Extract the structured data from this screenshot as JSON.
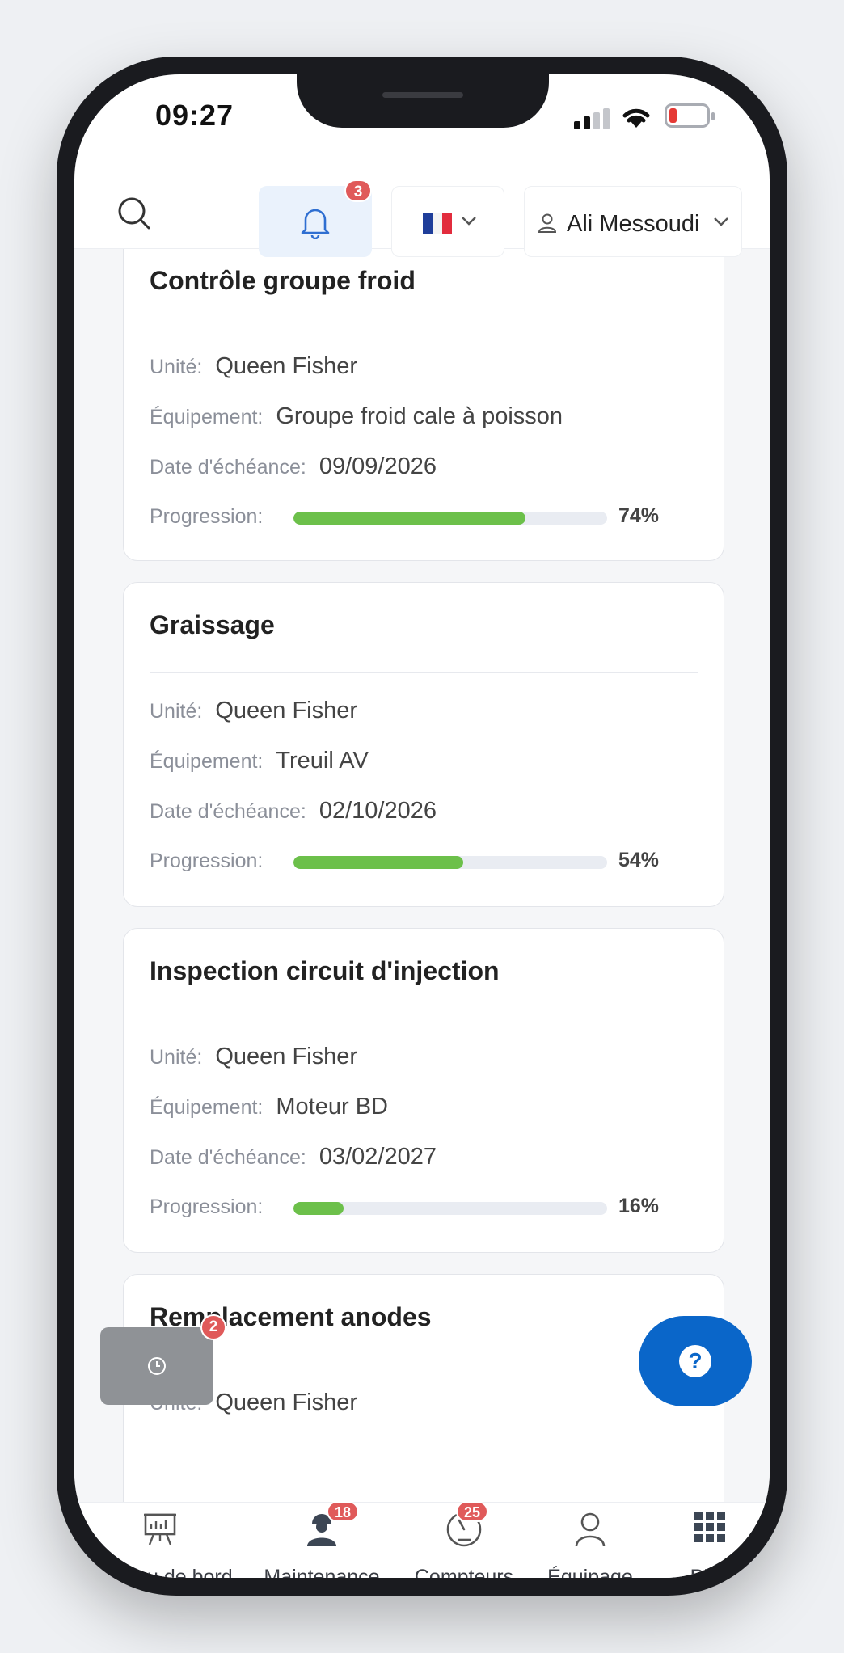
{
  "status_bar": {
    "time": "09:27"
  },
  "header": {
    "notification_count": "3",
    "language": "fr",
    "user_name": "Ali Messoudi"
  },
  "tasks": [
    {
      "title": "Contrôle groupe froid",
      "unit_label": "Unité:",
      "unit": "Queen Fisher",
      "equipment_label": "Équipement:",
      "equipment": "Groupe froid cale à poisson",
      "due_label": "Date d'échéance:",
      "due_date": "09/09/2026",
      "progress_label": "Progression:",
      "progress": 74,
      "progress_text": "74%"
    },
    {
      "title": "Graissage",
      "unit_label": "Unité:",
      "unit": "Queen Fisher",
      "equipment_label": "Équipement:",
      "equipment": "Treuil AV",
      "due_label": "Date d'échéance:",
      "due_date": "02/10/2026",
      "progress_label": "Progression:",
      "progress": 54,
      "progress_text": "54%"
    },
    {
      "title": "Inspection circuit d'injection",
      "unit_label": "Unité:",
      "unit": "Queen Fisher",
      "equipment_label": "Équipement:",
      "equipment": "Moteur BD",
      "due_label": "Date d'échéance:",
      "due_date": "03/02/2027",
      "progress_label": "Progression:",
      "progress": 16,
      "progress_text": "16%"
    },
    {
      "title": "Remplacement anodes",
      "unit_label": "Unité:",
      "unit": "Queen Fisher"
    }
  ],
  "floating": {
    "timer_badge": "2",
    "help_symbol": "?"
  },
  "bottom_nav": [
    {
      "label": "Tableau de bord",
      "icon": "presentation-board-icon"
    },
    {
      "label": "Maintenance",
      "icon": "worker-icon",
      "badge": "18"
    },
    {
      "label": "Compteurs",
      "icon": "gauge-icon",
      "badge": "25"
    },
    {
      "label": "Équipage",
      "icon": "person-icon"
    },
    {
      "label": "Plus",
      "icon": "grid-icon"
    }
  ],
  "colors": {
    "accent": "#0a66c9",
    "progress": "#6cc04a",
    "badge": "#e05a5a",
    "battery_low": "#e53935"
  }
}
